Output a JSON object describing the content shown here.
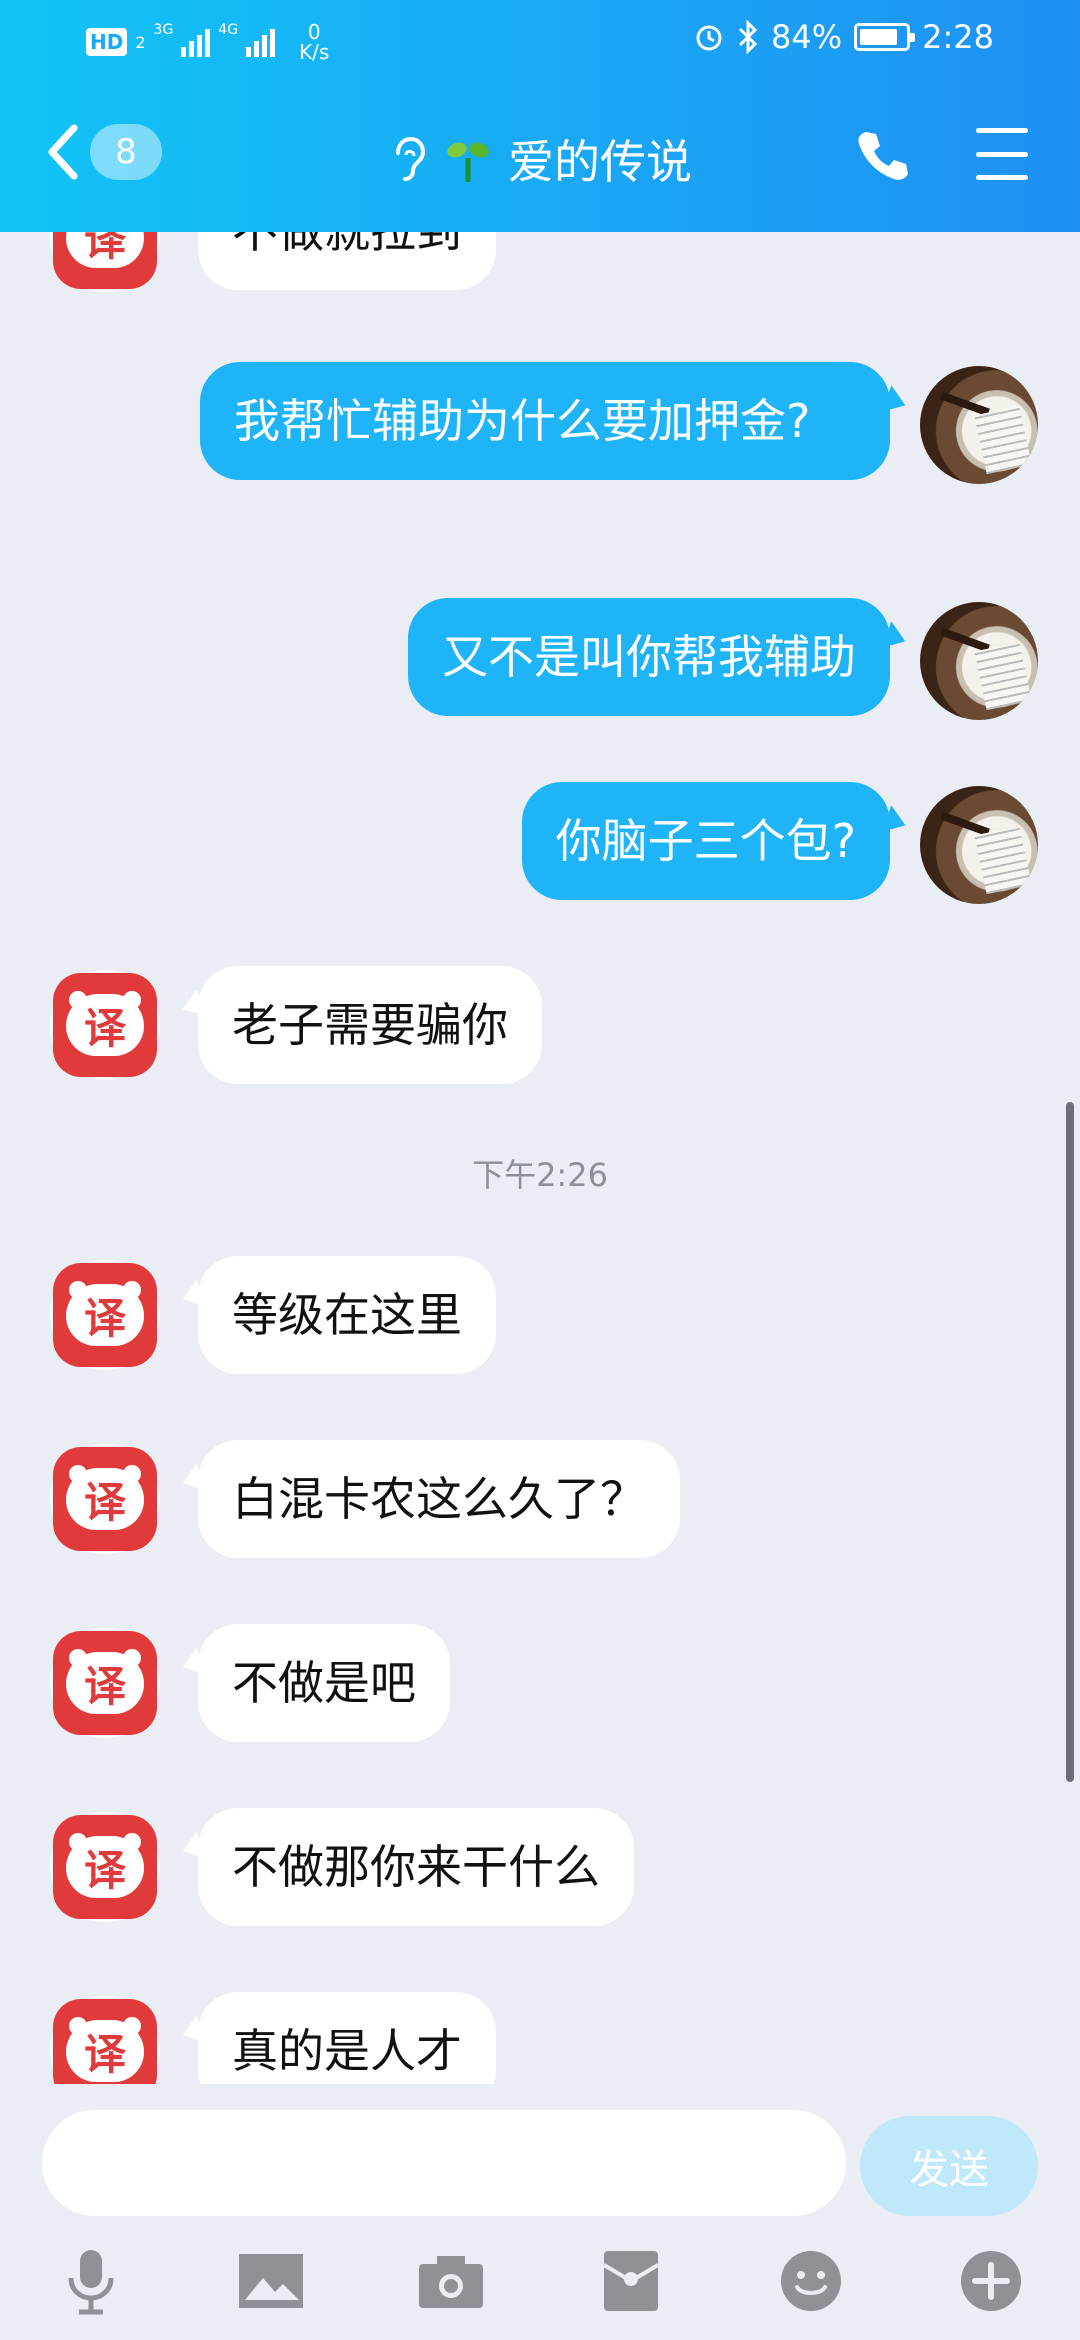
{
  "status_bar": {
    "hd": "HD",
    "sim_index": "2",
    "network_1": "3G",
    "network_2": "4G",
    "net_speed_value": "0",
    "net_speed_unit": "K/s",
    "battery_percent": "84%",
    "battery_level": 0.84,
    "time": "2:28"
  },
  "nav": {
    "back_badge": "8",
    "title": "爱的传说",
    "accent_color": "#1fb4f7"
  },
  "messages": [
    {
      "side": "in",
      "text": "不做就拉到"
    },
    {
      "side": "out",
      "text": "我帮忙辅助为什么要加押金?"
    },
    {
      "side": "out",
      "text": "又不是叫你帮我辅助"
    },
    {
      "side": "out",
      "text": "你脑子三个包?"
    },
    {
      "side": "in",
      "text": "老子需要骗你"
    },
    {
      "side": "in",
      "text": "等级在这里"
    },
    {
      "side": "in",
      "text": "白混卡农这么久了？"
    },
    {
      "side": "in",
      "text": "不做是吧"
    },
    {
      "side": "in",
      "text": "不做那你来干什么"
    },
    {
      "side": "in",
      "text": "真的是人才"
    }
  ],
  "timestamp": "下午2:26",
  "avatar_left_char": "译",
  "input": {
    "value": "",
    "send_label": "发送"
  }
}
